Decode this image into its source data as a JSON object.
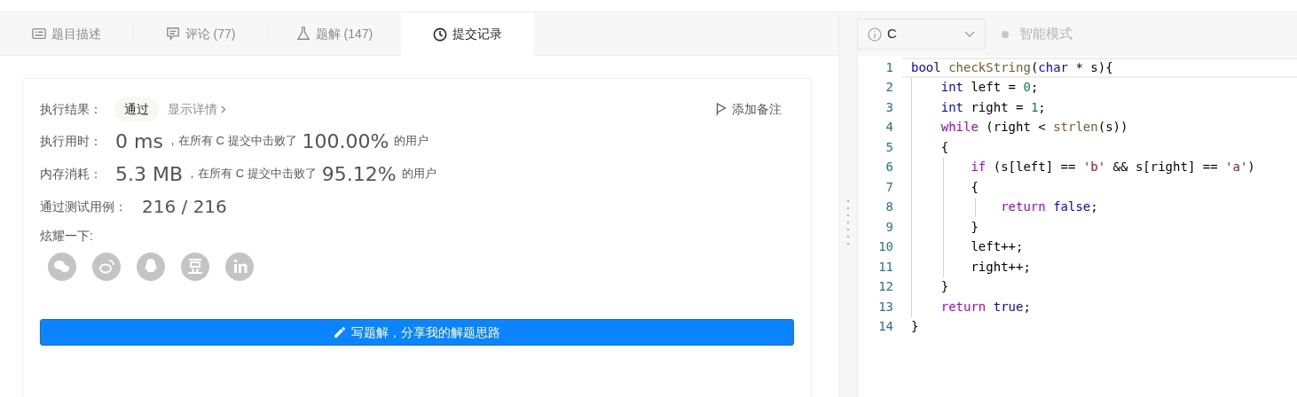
{
  "tabs": [
    {
      "label": "题目描述",
      "selected": false
    },
    {
      "label": "评论 (77)",
      "selected": false
    },
    {
      "label": "题解 (147)",
      "selected": false
    },
    {
      "label": "提交记录",
      "selected": true
    }
  ],
  "result": {
    "label": "执行结果：",
    "status": "通过",
    "details_link": "显示详情",
    "note_button": "添加备注"
  },
  "stats": [
    {
      "label": "执行用时：",
      "value": "0 ms",
      "text": "，在所有 C 提交中击败了",
      "percent": "100.00%",
      "suffix": "的用户"
    },
    {
      "label": "内存消耗：",
      "value": "5.3 MB",
      "text": "，在所有 C 提交中击败了",
      "percent": "95.12%",
      "suffix": "的用户"
    }
  ],
  "tests": {
    "label": "通过测试用例：",
    "value": "216 / 216"
  },
  "share": {
    "label": "炫耀一下:"
  },
  "write_button": "写题解，分享我的解题思路",
  "editor": {
    "language": "C",
    "mode_label": "智能模式",
    "lines": [
      {
        "number": "1",
        "active": true,
        "tokens": [
          {
            "kind": "type",
            "text": "bool"
          },
          {
            "kind": "func",
            "text": " checkString"
          },
          {
            "kind": "plain",
            "text": "("
          },
          {
            "kind": "type",
            "text": "char"
          },
          {
            "kind": "plain",
            "text": " * s){"
          }
        ]
      },
      {
        "number": "2",
        "active": false,
        "tokens": [
          {
            "kind": "type",
            "text": "    int"
          },
          {
            "kind": "plain",
            "text": " left = "
          },
          {
            "kind": "number",
            "text": "0"
          },
          {
            "kind": "plain",
            "text": ";"
          }
        ]
      },
      {
        "number": "3",
        "active": false,
        "tokens": [
          {
            "kind": "type",
            "text": "    int"
          },
          {
            "kind": "plain",
            "text": " right = "
          },
          {
            "kind": "number",
            "text": "1"
          },
          {
            "kind": "plain",
            "text": ";"
          }
        ]
      },
      {
        "number": "4",
        "active": false,
        "tokens": [
          {
            "kind": "control",
            "text": "    while"
          },
          {
            "kind": "plain",
            "text": " (right < "
          },
          {
            "kind": "func",
            "text": "strlen"
          },
          {
            "kind": "plain",
            "text": "(s))"
          }
        ]
      },
      {
        "number": "5",
        "active": false,
        "tokens": [
          {
            "kind": "plain",
            "text": "    {"
          }
        ]
      },
      {
        "number": "6",
        "active": false,
        "tokens": [
          {
            "kind": "control",
            "text": "        if"
          },
          {
            "kind": "plain",
            "text": " (s[left] == "
          },
          {
            "kind": "string",
            "text": "'b'"
          },
          {
            "kind": "plain",
            "text": " && s[right] == "
          },
          {
            "kind": "string",
            "text": "'a'"
          },
          {
            "kind": "plain",
            "text": ")"
          }
        ]
      },
      {
        "number": "7",
        "active": false,
        "tokens": [
          {
            "kind": "plain",
            "text": "        {"
          }
        ]
      },
      {
        "number": "8",
        "active": false,
        "tokens": [
          {
            "kind": "control",
            "text": "            return"
          },
          {
            "kind": "type",
            "text": " false"
          },
          {
            "kind": "plain",
            "text": ";"
          }
        ]
      },
      {
        "number": "9",
        "active": false,
        "tokens": [
          {
            "kind": "plain",
            "text": "        }"
          }
        ]
      },
      {
        "number": "10",
        "active": false,
        "tokens": [
          {
            "kind": "plain",
            "text": "        left++;"
          }
        ]
      },
      {
        "number": "11",
        "active": false,
        "tokens": [
          {
            "kind": "plain",
            "text": "        right++;"
          }
        ]
      },
      {
        "number": "12",
        "active": false,
        "tokens": [
          {
            "kind": "plain",
            "text": "    }"
          }
        ]
      },
      {
        "number": "13",
        "active": false,
        "tokens": [
          {
            "kind": "control",
            "text": "    return"
          },
          {
            "kind": "type",
            "text": " true"
          },
          {
            "kind": "plain",
            "text": ";"
          }
        ]
      },
      {
        "number": "14",
        "active": false,
        "tokens": [
          {
            "kind": "plain",
            "text": "}"
          }
        ]
      }
    ]
  }
}
